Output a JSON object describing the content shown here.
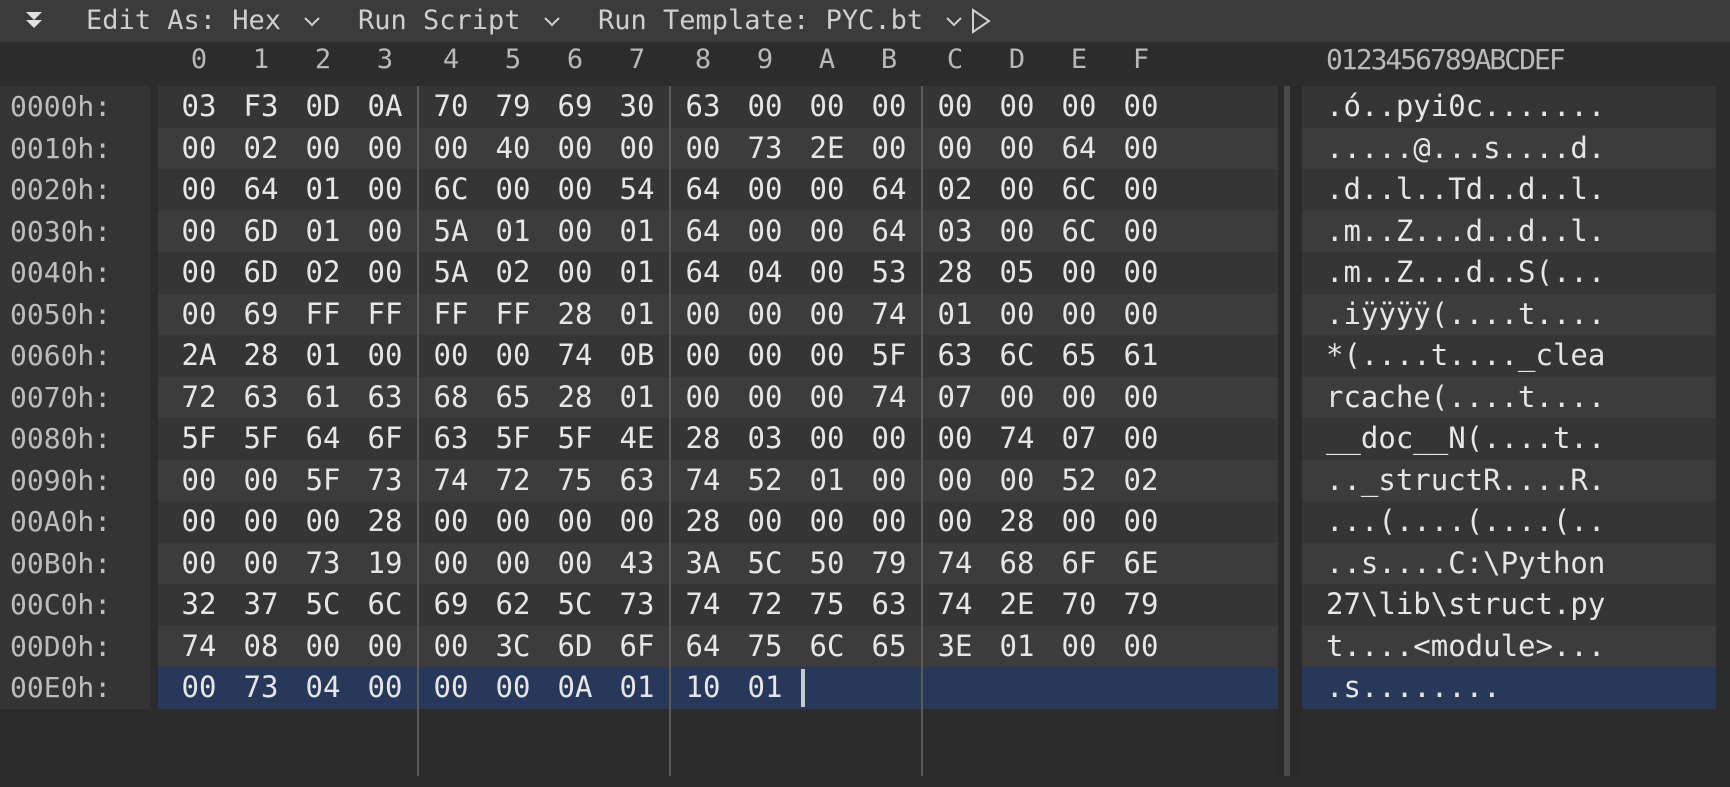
{
  "toolbar": {
    "edit_as_label": "Edit As: Hex",
    "run_script_label": "Run Script",
    "run_template_label": "Run Template: PYC.bt"
  },
  "columns": [
    "0",
    "1",
    "2",
    "3",
    "4",
    "5",
    "6",
    "7",
    "8",
    "9",
    "A",
    "B",
    "C",
    "D",
    "E",
    "F"
  ],
  "ascii_header": "0123456789ABCDEF",
  "rows": [
    {
      "offset": "0000h:",
      "bytes": [
        "03",
        "F3",
        "0D",
        "0A",
        "70",
        "79",
        "69",
        "30",
        "63",
        "00",
        "00",
        "00",
        "00",
        "00",
        "00",
        "00"
      ],
      "ascii": ".ó..pyi0c......."
    },
    {
      "offset": "0010h:",
      "bytes": [
        "00",
        "02",
        "00",
        "00",
        "00",
        "40",
        "00",
        "00",
        "00",
        "73",
        "2E",
        "00",
        "00",
        "00",
        "64",
        "00"
      ],
      "ascii": ".....@...s....d."
    },
    {
      "offset": "0020h:",
      "bytes": [
        "00",
        "64",
        "01",
        "00",
        "6C",
        "00",
        "00",
        "54",
        "64",
        "00",
        "00",
        "64",
        "02",
        "00",
        "6C",
        "00"
      ],
      "ascii": ".d..l..Td..d..l."
    },
    {
      "offset": "0030h:",
      "bytes": [
        "00",
        "6D",
        "01",
        "00",
        "5A",
        "01",
        "00",
        "01",
        "64",
        "00",
        "00",
        "64",
        "03",
        "00",
        "6C",
        "00"
      ],
      "ascii": ".m..Z...d..d..l."
    },
    {
      "offset": "0040h:",
      "bytes": [
        "00",
        "6D",
        "02",
        "00",
        "5A",
        "02",
        "00",
        "01",
        "64",
        "04",
        "00",
        "53",
        "28",
        "05",
        "00",
        "00"
      ],
      "ascii": ".m..Z...d..S(..."
    },
    {
      "offset": "0050h:",
      "bytes": [
        "00",
        "69",
        "FF",
        "FF",
        "FF",
        "FF",
        "28",
        "01",
        "00",
        "00",
        "00",
        "74",
        "01",
        "00",
        "00",
        "00"
      ],
      "ascii": ".iÿÿÿÿ(....t...."
    },
    {
      "offset": "0060h:",
      "bytes": [
        "2A",
        "28",
        "01",
        "00",
        "00",
        "00",
        "74",
        "0B",
        "00",
        "00",
        "00",
        "5F",
        "63",
        "6C",
        "65",
        "61"
      ],
      "ascii": "*(....t...._clea"
    },
    {
      "offset": "0070h:",
      "bytes": [
        "72",
        "63",
        "61",
        "63",
        "68",
        "65",
        "28",
        "01",
        "00",
        "00",
        "00",
        "74",
        "07",
        "00",
        "00",
        "00"
      ],
      "ascii": "rcache(....t...."
    },
    {
      "offset": "0080h:",
      "bytes": [
        "5F",
        "5F",
        "64",
        "6F",
        "63",
        "5F",
        "5F",
        "4E",
        "28",
        "03",
        "00",
        "00",
        "00",
        "74",
        "07",
        "00"
      ],
      "ascii": "__doc__N(....t.."
    },
    {
      "offset": "0090h:",
      "bytes": [
        "00",
        "00",
        "5F",
        "73",
        "74",
        "72",
        "75",
        "63",
        "74",
        "52",
        "01",
        "00",
        "00",
        "00",
        "52",
        "02"
      ],
      "ascii": ".._structR....R."
    },
    {
      "offset": "00A0h:",
      "bytes": [
        "00",
        "00",
        "00",
        "28",
        "00",
        "00",
        "00",
        "00",
        "28",
        "00",
        "00",
        "00",
        "00",
        "28",
        "00",
        "00"
      ],
      "ascii": "...(....(....(.."
    },
    {
      "offset": "00B0h:",
      "bytes": [
        "00",
        "00",
        "73",
        "19",
        "00",
        "00",
        "00",
        "43",
        "3A",
        "5C",
        "50",
        "79",
        "74",
        "68",
        "6F",
        "6E"
      ],
      "ascii": "..s....C:\\Python"
    },
    {
      "offset": "00C0h:",
      "bytes": [
        "32",
        "37",
        "5C",
        "6C",
        "69",
        "62",
        "5C",
        "73",
        "74",
        "72",
        "75",
        "63",
        "74",
        "2E",
        "70",
        "79"
      ],
      "ascii": "27\\lib\\struct.py"
    },
    {
      "offset": "00D0h:",
      "bytes": [
        "74",
        "08",
        "00",
        "00",
        "00",
        "3C",
        "6D",
        "6F",
        "64",
        "75",
        "6C",
        "65",
        "3E",
        "01",
        "00",
        "00"
      ],
      "ascii": "t....<module>..."
    },
    {
      "offset": "00E0h:",
      "bytes": [
        "00",
        "73",
        "04",
        "00",
        "00",
        "00",
        "0A",
        "01",
        "10",
        "01"
      ],
      "ascii": ".s........"
    }
  ],
  "colors": {
    "selection_row": "#27385a",
    "text": "#e6e6e6"
  }
}
